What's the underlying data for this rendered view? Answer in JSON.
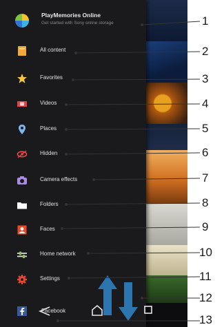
{
  "playmemories": {
    "title": "PlayMemories Online",
    "subtitle": "Get started with Sony online storage"
  },
  "menu": [
    {
      "label": "All content",
      "icon": "folder-icon"
    },
    {
      "label": "Favorites",
      "icon": "star-icon"
    },
    {
      "label": "Videos",
      "icon": "film-icon"
    },
    {
      "label": "Places",
      "icon": "location-pin-icon"
    },
    {
      "label": "Hidden",
      "icon": "hidden-eye-icon"
    },
    {
      "label": "Camera effects",
      "icon": "camera-icon"
    },
    {
      "label": "Folders",
      "icon": "folder-outline-icon"
    },
    {
      "label": "Faces",
      "icon": "face-icon"
    },
    {
      "label": "Home network",
      "icon": "network-icon"
    },
    {
      "label": "Settings",
      "icon": "gear-icon"
    },
    {
      "label": "Facebook",
      "icon": "facebook-icon"
    }
  ],
  "navbar": {
    "back_icon": "back-icon",
    "home_icon": "home-icon",
    "recents_icon": "recents-icon"
  },
  "scroll_arrows": "up-down-arrows-icon",
  "callouts": [
    "1",
    "2",
    "3",
    "4",
    "5",
    "6",
    "7",
    "8",
    "9",
    "10",
    "11",
    "12",
    "13"
  ],
  "colors": {
    "drawer_background": "#1a1a1d",
    "arrow_blue": "#2f7fbf",
    "text_light": "#e0e0e0"
  }
}
